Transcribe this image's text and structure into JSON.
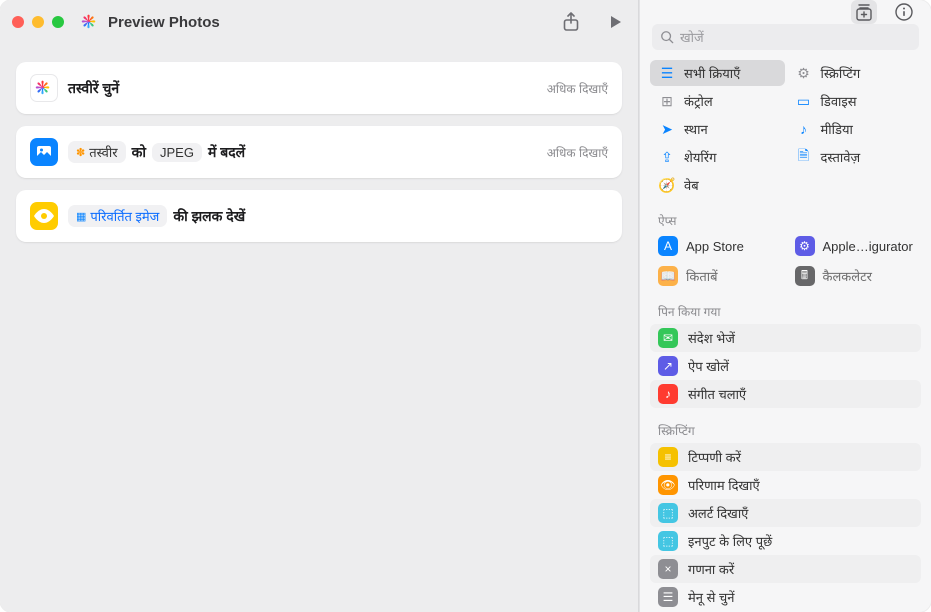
{
  "window": {
    "title": "Preview Photos"
  },
  "toolbar": {
    "share_icon": "share-icon",
    "run_icon": "play-icon"
  },
  "actions": [
    {
      "id": "select-photos",
      "title_plain": "तस्वीरें चुनें",
      "more": "अधिक दिखाएँ"
    },
    {
      "id": "convert",
      "pre": "",
      "token1": "तस्वीर",
      "mid1": "को",
      "token2": "JPEG",
      "mid2": "में बदलें",
      "more": "अधिक दिखाएँ"
    },
    {
      "id": "preview",
      "token1": "परिवर्तित इमेज",
      "after": "की झलक देखें"
    }
  ],
  "sidebar": {
    "search_placeholder": "खोजें",
    "categories_left": [
      {
        "label": "सभी क्रियाएँ",
        "icon": "☰",
        "color": "#0a84ff",
        "selected": true
      },
      {
        "label": "कंट्रोल",
        "icon": "⊕",
        "color": "#8e8e93"
      },
      {
        "label": "स्थान",
        "icon": "➤",
        "color": "#0a84ff"
      },
      {
        "label": "शेयरिंग",
        "icon": "⇪",
        "color": "#0a84ff"
      },
      {
        "label": "वेब",
        "icon": "⊘",
        "color": "#0a84ff"
      }
    ],
    "categories_right": [
      {
        "label": "स्क्रिप्टिंग",
        "icon": "⚙",
        "color": "#8e8e93"
      },
      {
        "label": "डिवाइस",
        "icon": "▭",
        "color": "#0a84ff"
      },
      {
        "label": "मीडिया",
        "icon": "♪",
        "color": "#0a84ff"
      },
      {
        "label": "दस्तावेज़",
        "icon": "🗎",
        "color": "#0a84ff"
      }
    ],
    "apps_heading": "ऐप्स",
    "apps": [
      {
        "label": "App Store",
        "bg": "#0a84ff",
        "glyph": "A"
      },
      {
        "label": "Apple…igurator",
        "bg": "#5e5ce6",
        "glyph": "⚙"
      },
      {
        "label": "किताबें",
        "bg": "#ff9500",
        "glyph": "📖"
      },
      {
        "label": "कैलकलेटर",
        "bg": "#3a3a3c",
        "glyph": "🖩"
      }
    ],
    "pinned_heading": "पिन किया गया",
    "pinned": [
      {
        "label": "संदेश भेजें",
        "bg": "#34c759",
        "glyph": "✉"
      },
      {
        "label": "ऐप खोलें",
        "bg": "#5e5ce6",
        "glyph": "↗"
      },
      {
        "label": "संगीत चलाएँ",
        "bg": "#ff3b30",
        "glyph": "♪"
      }
    ],
    "scripting_heading": "स्क्रिप्टिंग",
    "scripting": [
      {
        "label": "टिप्पणी करें",
        "bg": "#f5c100",
        "glyph": "≡"
      },
      {
        "label": "परिणाम दिखाएँ",
        "bg": "#ff9500",
        "glyph": "👁"
      },
      {
        "label": "अलर्ट दिखाएँ",
        "bg": "#44c6e3",
        "glyph": "⬚"
      },
      {
        "label": "इनपुट के लिए पूछें",
        "bg": "#44c6e3",
        "glyph": "⬚"
      },
      {
        "label": "गणना करें",
        "bg": "#8e8e93",
        "glyph": "×"
      },
      {
        "label": "मेनू से चुनें",
        "bg": "#8e8e93",
        "glyph": "☰"
      }
    ]
  }
}
